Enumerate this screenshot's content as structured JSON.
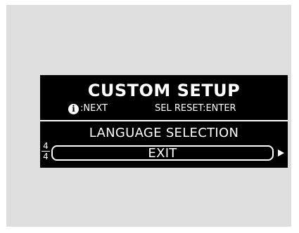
{
  "screen": {
    "title": "CUSTOM SETUP",
    "hint_next": ":NEXT",
    "hint_reset": "SEL RESET:ENTER",
    "menu_item": "LANGUAGE SELECTION",
    "selected_item": "EXIT",
    "page_current": "4",
    "page_total": "4"
  },
  "icons": {
    "info": "info-icon",
    "arrow": "right-triangle-arrow-icon"
  },
  "colors": {
    "screen_background": "#000000",
    "text": "#ffffff",
    "panel_background": "#dedede"
  }
}
